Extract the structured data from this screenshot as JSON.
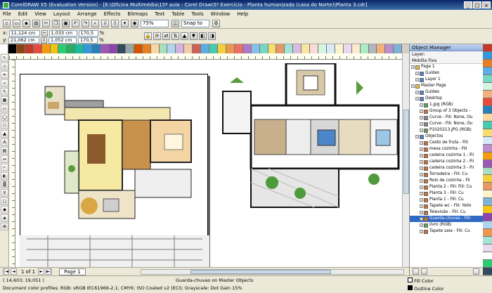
{
  "window": {
    "title": "CorelDRAW X5 (Evaluation Version) - [E:\\Oficina Multimédia\\15ª aula - Corel Draw\\5º Exercício - Planta humanizada (casa do Norte)\\Planta 3.cdr]",
    "min_label": "_",
    "max_label": "□",
    "close_label": "x"
  },
  "menu": [
    "File",
    "Edit",
    "View",
    "Layout",
    "Arrange",
    "Effects",
    "Bitmaps",
    "Text",
    "Table",
    "Tools",
    "Window",
    "Help"
  ],
  "toolbar": {
    "zoom": "75%",
    "snap": "Snap to"
  },
  "propbar": {
    "x_label": "x:",
    "x": "11,124 cm",
    "y_label": "y:",
    "y": "21,062 cm",
    "w": "1,033 cm",
    "h": "1,052 cm",
    "sx": "170,5",
    "sy": "170,5",
    "pct": "%"
  },
  "colors": {
    "palette": [
      "#ffffff",
      "#000000",
      "#8b4513",
      "#c0392b",
      "#e74c3c",
      "#f39c12",
      "#f1c40f",
      "#2ecc71",
      "#27ae60",
      "#1abc9c",
      "#3498db",
      "#2980b9",
      "#9b59b6",
      "#8e44ad",
      "#34495e",
      "#95a5a6",
      "#d35400",
      "#e67e22",
      "#fad7a0",
      "#a9dfbf",
      "#aed6f1",
      "#d2b4de",
      "#f5cba7",
      "#cd6155",
      "#5dade2",
      "#48c9b0",
      "#f4d03f",
      "#eb984e",
      "#ec7063",
      "#af7ac5",
      "#85c1e9",
      "#76d7c4",
      "#f7dc6f",
      "#e59866",
      "#a3e4d7",
      "#d7bde2",
      "#f9e79f",
      "#fadbd8",
      "#d5f5e3",
      "#d6eaf8",
      "#fcf3cf",
      "#e8daef",
      "#fdebd0",
      "#abebc6",
      "#aeb6bf",
      "#f0b27a",
      "#bb8fce",
      "#7fb3d5"
    ],
    "accent": "#316ac5"
  },
  "pagenav": {
    "first": "|◄",
    "prev": "◄",
    "page_of": "1 of 1",
    "next": "►",
    "last": "►|",
    "tab": "Page 1"
  },
  "status": {
    "coords": "( 14,603; 19,051 )",
    "message": "Guarda-chuvas on Master Objects",
    "profiles": "Document color profiles: RGB: sRGB IEC61966-2.1; CMYK: ISO Coated v2 (ECI); Grayscale: Dot Gain 15%",
    "fill_label": "Fill Color",
    "outline_label": "Outline Color"
  },
  "object_manager": {
    "title": "Object Manager",
    "layer_label": "Layer:",
    "layer_name": "Mobília Fixa",
    "rows": [
      {
        "text": "Page 1",
        "indent": 0,
        "icon": "page"
      },
      {
        "text": "Guides",
        "indent": 1,
        "icon": "layer"
      },
      {
        "text": "Layer 1",
        "indent": 1,
        "icon": "layer"
      },
      {
        "text": "Master Page",
        "indent": 0,
        "icon": "page"
      },
      {
        "text": "Guides",
        "indent": 1,
        "icon": "layer"
      },
      {
        "text": "Desktop",
        "indent": 1,
        "icon": "layer"
      },
      {
        "text": "1.jpg (RGB)",
        "indent": 2,
        "icon": "bitmap"
      },
      {
        "text": "Group of 3 Objects -",
        "indent": 2,
        "icon": "group"
      },
      {
        "text": "Curve - Fill: None, Ou",
        "indent": 2,
        "icon": "curve"
      },
      {
        "text": "Curve - Fill: None, Ou",
        "indent": 2,
        "icon": "curve"
      },
      {
        "text": "P1020213.JPG (RGB)",
        "indent": 2,
        "icon": "bitmap"
      },
      {
        "text": "Objectos",
        "indent": 1,
        "icon": "layer"
      },
      {
        "text": "Cesto de fruta - Fill",
        "indent": 2,
        "icon": "group"
      },
      {
        "text": "mesa cozinha - Fill",
        "indent": 2,
        "icon": "group"
      },
      {
        "text": "cadeira cozinha 1 - Fil",
        "indent": 2,
        "icon": "group"
      },
      {
        "text": "cadeira cozinha 2 - Fil",
        "indent": 2,
        "icon": "group"
      },
      {
        "text": "cadeira cozinha 3 - Fil",
        "indent": 2,
        "icon": "group"
      },
      {
        "text": "Torradeira - Fill: Cu",
        "indent": 2,
        "icon": "group"
      },
      {
        "text": "Rolo de cozinha - Fil",
        "indent": 2,
        "icon": "group"
      },
      {
        "text": "Planta 2 - Fill: Fill: Cu",
        "indent": 2,
        "icon": "group"
      },
      {
        "text": "Planta 3 - Fill: Cu",
        "indent": 2,
        "icon": "group"
      },
      {
        "text": "Planta 1 - Fill: Cu",
        "indent": 2,
        "icon": "group"
      },
      {
        "text": "Tapete wc - Fill: Yello",
        "indent": 2,
        "icon": "group"
      },
      {
        "text": "Televisão - Fill: Cu",
        "indent": 2,
        "icon": "group"
      },
      {
        "text": "Guarda-chuvas - Fill:",
        "indent": 2,
        "icon": "group",
        "selected": true
      },
      {
        "text": "livro (RGB)",
        "indent": 2,
        "icon": "bitmap"
      },
      {
        "text": "Tapete sala - Fill: Cu",
        "indent": 2,
        "icon": "group"
      }
    ]
  }
}
